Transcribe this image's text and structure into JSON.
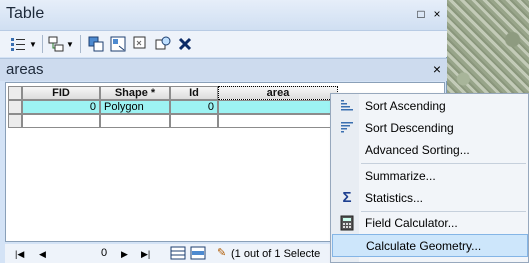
{
  "window": {
    "title": "Table",
    "restore_label": "□",
    "close_label": "×"
  },
  "tab": {
    "label": "areas",
    "close_label": "×"
  },
  "grid": {
    "columns": [
      "FID",
      "Shape *",
      "Id",
      "area"
    ],
    "rows": [
      {
        "FID": "0",
        "Shape": "Polygon",
        "Id": "0",
        "area": ""
      }
    ]
  },
  "status": {
    "record": "0",
    "selection_text": "(1 out of 1 Selecte"
  },
  "context_menu": {
    "items": [
      {
        "label": "Sort Ascending",
        "icon": "sort-ascending-icon"
      },
      {
        "label": "Sort Descending",
        "icon": "sort-descending-icon"
      },
      {
        "label": "Advanced Sorting...",
        "icon": ""
      },
      {
        "label": "Summarize...",
        "icon": ""
      },
      {
        "label": "Statistics...",
        "icon": "sigma-icon"
      },
      {
        "label": "Field Calculator...",
        "icon": "calculator-icon"
      },
      {
        "label": "Calculate Geometry...",
        "icon": ""
      }
    ],
    "highlighted": "Calculate Geometry..."
  },
  "colors": {
    "selected_row": "#9df3f3",
    "menu_highlight": "#cde6fb"
  }
}
